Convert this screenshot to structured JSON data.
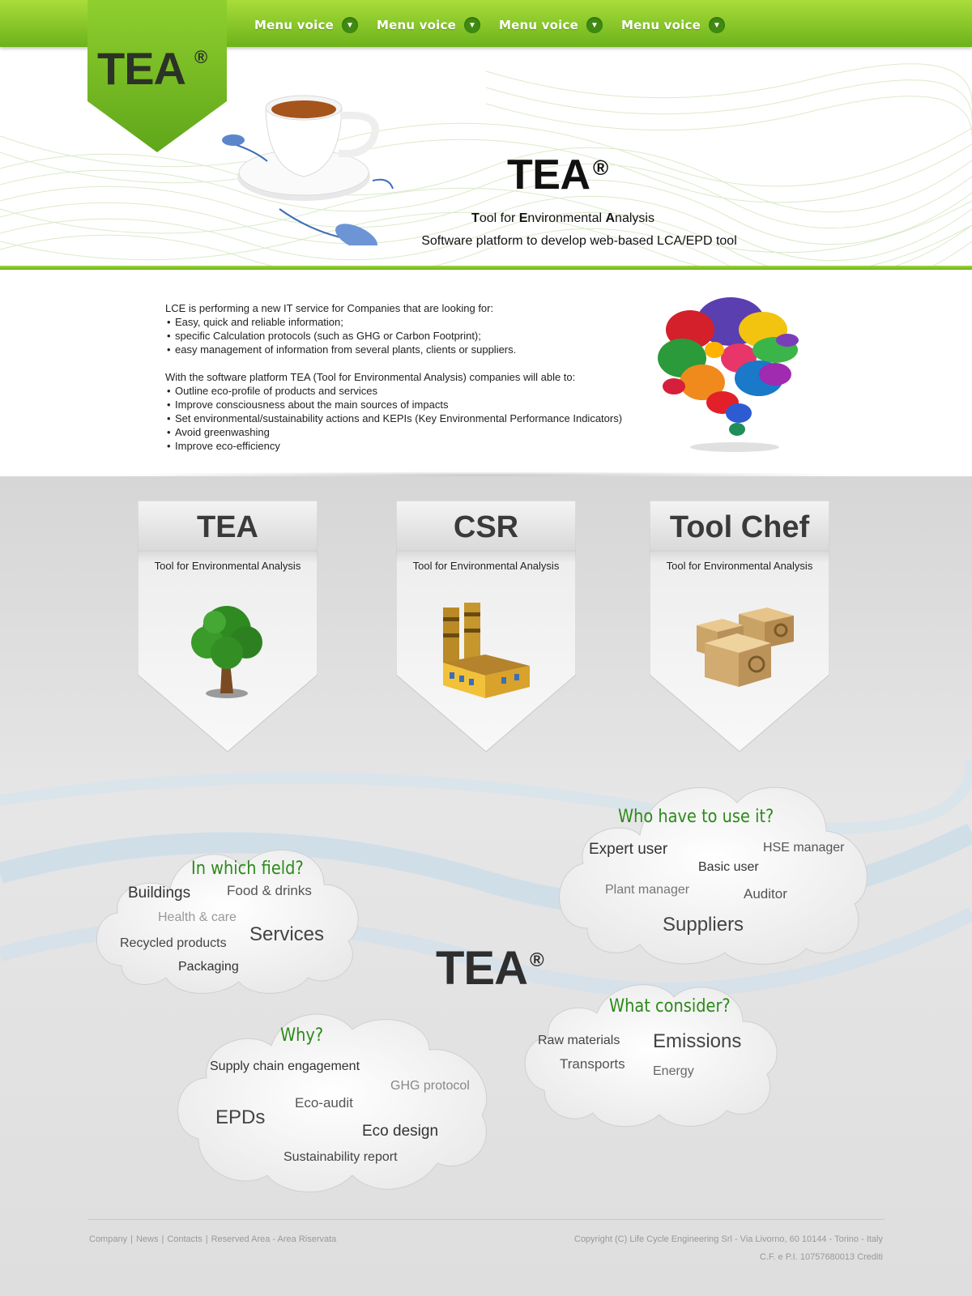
{
  "nav": {
    "items": [
      {
        "label": "Menu voice"
      },
      {
        "label": "Menu voice"
      },
      {
        "label": "Menu voice"
      },
      {
        "label": "Menu voice"
      }
    ],
    "chevron_icon": "chevron-down-icon",
    "colors": {
      "bar": "#8ccb2a",
      "chevron": "#3f8a12"
    }
  },
  "logo": {
    "text": "TEA",
    "reg": "®"
  },
  "hero": {
    "title": "TEA",
    "reg": "®",
    "subtitle": "Tool for Environmental Analysis",
    "tagline": "Software platform to develop web-based LCA/EPD tool",
    "image": "teacup-with-computer-mouse"
  },
  "intro": {
    "para1": "LCE is performing a new IT service for Companies that are looking for:",
    "list1": [
      "Easy, quick and reliable information;",
      "specific Calculation protocols (such as GHG or Carbon Footprint);",
      "easy management of information from several plants, clients or suppliers."
    ],
    "para2": "With the software platform TEA (Tool for Environmental Analysis) companies will  able  to:",
    "list2": [
      "Outline eco-profile of products and services",
      "Improve consciousness about the main sources of impacts",
      "Set environmental/sustainability actions and KEPIs (Key Environmental Performance Indicators)",
      "Avoid greenwashing",
      "Improve eco-efficiency"
    ],
    "image": "speech-bubbles-cluster"
  },
  "cards": [
    {
      "title": "TEA",
      "subtitle": "Tool for Environmental Analysis",
      "icon": "tree-icon"
    },
    {
      "title": "CSR",
      "subtitle": "Tool for Environmental Analysis",
      "icon": "factory-icon"
    },
    {
      "title": "Tool Chef",
      "subtitle": "Tool for Environmental Analysis",
      "icon": "boxes-icon"
    }
  ],
  "clouds": {
    "field": {
      "heading": "In which field?",
      "words": [
        "Buildings",
        "Food & drinks",
        "Health & care",
        "Services",
        "Recycled products",
        "Packaging"
      ]
    },
    "who": {
      "heading": "Who have to use it?",
      "words": [
        "Expert user",
        "HSE manager",
        "Basic user",
        "Plant manager",
        "Auditor",
        "Suppliers"
      ]
    },
    "why": {
      "heading": "Why?",
      "words": [
        "Supply chain engagement",
        "GHG protocol",
        "Eco-audit",
        "EPDs",
        "Eco design",
        "Sustainability report"
      ]
    },
    "consider": {
      "heading": "What consider?",
      "words": [
        "Raw materials",
        "Emissions",
        "Transports",
        "Energy"
      ]
    }
  },
  "center": {
    "title": "TEA",
    "reg": "®"
  },
  "footer": {
    "links": [
      "Company",
      "News",
      "Contacts",
      "Reserved Area - Area Riservata"
    ],
    "separator": "|",
    "copyright": "Copyright (C) Life Cycle Engineering Srl - Via Livorno, 60 10144 - Torino - Italy",
    "cf": "C.F. e P.I. 10757680013 Crediti"
  }
}
